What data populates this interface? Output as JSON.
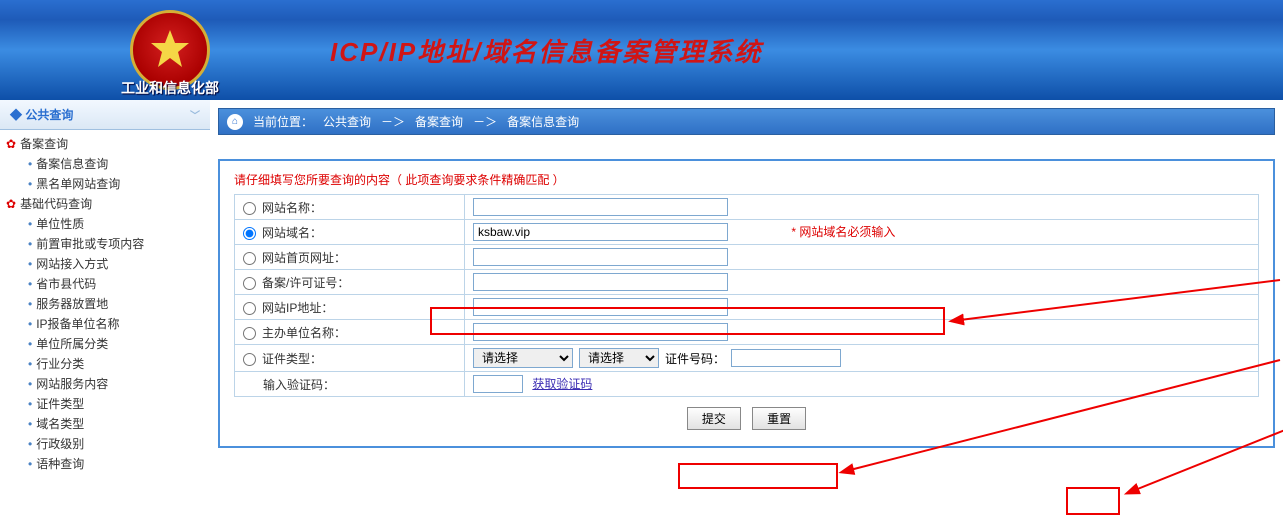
{
  "header": {
    "ministry": "工业和信息化部",
    "site_title": "ICP/IP地址/域名信息备案管理系统"
  },
  "sidebar": {
    "title": "公共查询",
    "groups": [
      {
        "label": "备案查询",
        "items": [
          {
            "label": "备案信息查询"
          },
          {
            "label": "黑名单网站查询"
          }
        ]
      },
      {
        "label": "基础代码查询",
        "items": [
          {
            "label": "单位性质"
          },
          {
            "label": "前置审批或专项内容"
          },
          {
            "label": "网站接入方式"
          },
          {
            "label": "省市县代码"
          },
          {
            "label": "服务器放置地"
          },
          {
            "label": "IP报备单位名称"
          },
          {
            "label": "单位所属分类"
          },
          {
            "label": "行业分类"
          },
          {
            "label": "网站服务内容"
          },
          {
            "label": "证件类型"
          },
          {
            "label": "域名类型"
          },
          {
            "label": "行政级别"
          },
          {
            "label": "语种查询"
          }
        ]
      }
    ]
  },
  "breadcrumb": {
    "prefix": "当前位置：",
    "path1": "公共查询",
    "sep": "－＞",
    "path2": "备案查询",
    "path3": "备案信息查询"
  },
  "form": {
    "note": "请仔细填写您所要查询的内容（ 此项查询要求条件精确匹配 ）",
    "rows": {
      "site_name": "网站名称：",
      "domain": "网站域名：",
      "homepage": "网站首页网址：",
      "license": "备案/许可证号：",
      "ip": "网站IP地址：",
      "sponsor": "主办单位名称：",
      "cert_type": "证件类型：",
      "captcha": "输入验证码："
    },
    "domain_value": "ksbaw.vip",
    "domain_note": "* 网站域名必须输入",
    "select_placeholder": "请选择",
    "cert_no_label": "证件号码：",
    "captcha_link": "获取验证码",
    "submit": "提交",
    "reset": "重置"
  }
}
